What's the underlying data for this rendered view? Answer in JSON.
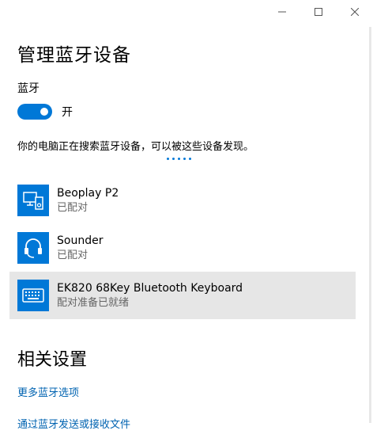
{
  "window": {
    "minimize_icon": "minimize-icon",
    "maximize_icon": "maximize-icon",
    "close_icon": "close-icon"
  },
  "page": {
    "title": "管理蓝牙设备"
  },
  "bluetooth": {
    "label": "蓝牙",
    "toggle_state": "开",
    "toggle_on": true,
    "accent_color": "#0078d7",
    "searching_text": "你的电脑正在搜索蓝牙设备，可以被这些设备发现。"
  },
  "devices": [
    {
      "name": "Beoplay P2",
      "status": "已配对",
      "icon": "phone-audio-device-icon"
    },
    {
      "name": "Sounder",
      "status": "已配对",
      "icon": "headset-icon"
    },
    {
      "name": "EK820 68Key Bluetooth Keyboard",
      "status": "配对准备已就绪",
      "icon": "keyboard-icon"
    }
  ],
  "related": {
    "title": "相关设置",
    "links": [
      "更多蓝牙选项",
      "通过蓝牙发送或接收文件"
    ]
  }
}
